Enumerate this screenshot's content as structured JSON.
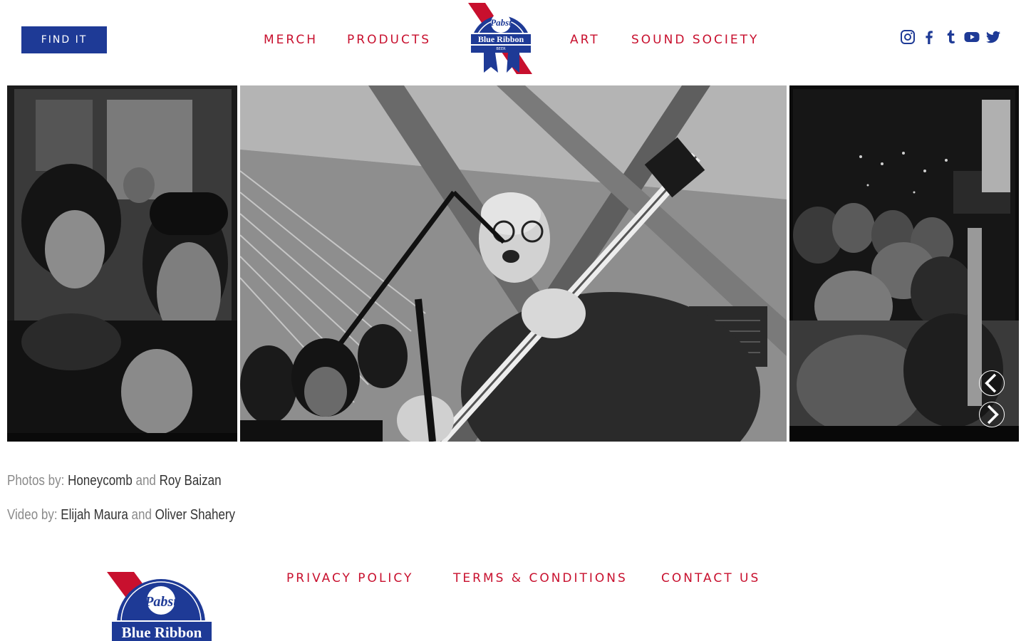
{
  "header": {
    "find_button": "FIND IT",
    "nav": {
      "merch": "MERCH",
      "products": "PRODUCTS",
      "art": "ART",
      "sound_society": "SOUND SOCIETY"
    },
    "logo": {
      "line1": "Pabst",
      "line2": "Blue Ribbon",
      "line3": "BEER"
    },
    "social_icons": [
      "instagram-icon",
      "facebook-icon",
      "tumblr-icon",
      "youtube-icon",
      "twitter-icon"
    ]
  },
  "gallery": {
    "prev_icon": "chevron-left-icon",
    "next_icon": "chevron-right-icon"
  },
  "credits": {
    "photos_prefix": "Photos by:",
    "photos_name1": "Honeycomb",
    "photos_and": "and",
    "photos_name2": "Roy Baizan",
    "video_prefix": "Video by:",
    "video_name1": "Elijah Maura",
    "video_and": "and",
    "video_name2": "Oliver Shahery"
  },
  "footer": {
    "logo": {
      "line1": "Pabst",
      "line2": "Blue Ribbon"
    },
    "links": {
      "privacy": "PRIVACY POLICY",
      "terms": "TERMS & CONDITIONS",
      "contact": "CONTACT US"
    }
  },
  "colors": {
    "brand_blue": "#1e3a96",
    "brand_red": "#c8102e",
    "text_muted": "#8a8a8a",
    "text_strong": "#333333"
  }
}
